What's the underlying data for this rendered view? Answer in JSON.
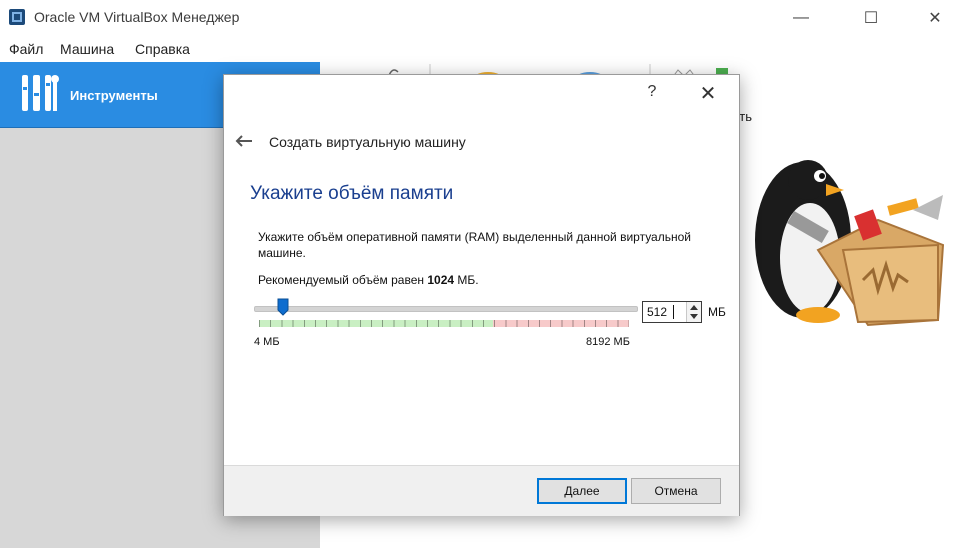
{
  "window": {
    "title": "Oracle VM VirtualBox Менеджер",
    "controls": {
      "minimize": "—",
      "maximize": "☐",
      "close": "✕"
    }
  },
  "menu": [
    "Файл",
    "Машина",
    "Справка"
  ],
  "sidebar": {
    "tools_label": "Инструменты",
    "tools_icon": "tools-icon"
  },
  "toolbar": {
    "partial_label": "ить"
  },
  "dialog": {
    "help": "?",
    "close": "✕",
    "wizard_title": "Создать виртуальную машину",
    "section_title": "Укажите объём памяти",
    "description": "Укажите объём оперативной памяти (RAM) выделенный данной виртуальной машине.",
    "recommended_prefix": "Рекомендуемый объём равен ",
    "recommended_value": "1024",
    "recommended_suffix": " МБ.",
    "slider": {
      "min_label": "4 МБ",
      "max_label": "8192 МБ",
      "value": 512,
      "min": 4,
      "max": 8192
    },
    "spin_value": "512",
    "unit": "МБ",
    "buttons": {
      "next": "Далее",
      "cancel": "Отмена"
    }
  },
  "colors": {
    "accent": "#2a8ce2",
    "section_title": "#1a3f8f",
    "slider_green": "#c9efc3",
    "slider_red": "#f7caca"
  }
}
